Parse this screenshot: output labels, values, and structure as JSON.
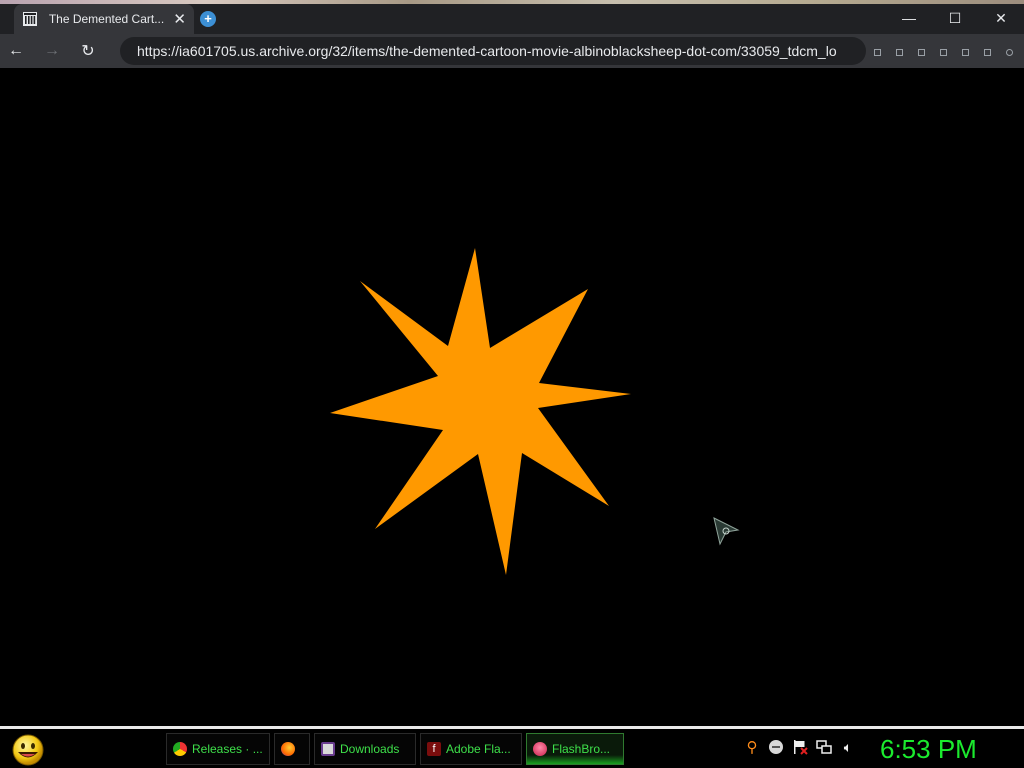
{
  "browser": {
    "tab": {
      "title": "The Demented Cart...",
      "favicon": "archive-icon",
      "close": "✕"
    },
    "new_tab_icon": "new-tab-icon",
    "window_controls": {
      "minimize": "—",
      "maximize": "☐",
      "close": "✕"
    },
    "nav": {
      "back": "←",
      "forward": "→",
      "reload": "↻"
    },
    "url": "https://ia601705.us.archive.org/32/items/the-demented-cartoon-movie-albinoblacksheep-dot-com/33059_tdcm_lo"
  },
  "content": {
    "star_color": "#ff9900",
    "background_color": "#000000",
    "cursor_icon": "arrow-cursor-icon"
  },
  "taskbar": {
    "tasks": [
      {
        "label": "Releases · ...",
        "icon": "chrome-icon"
      },
      {
        "label": "",
        "icon": "firefox-icon"
      },
      {
        "label": "Downloads",
        "icon": "folder-icon"
      },
      {
        "label": "Adobe Fla...",
        "icon": "flash-icon"
      },
      {
        "label": "FlashBro...",
        "icon": "flashbrowser-icon"
      }
    ],
    "tray": [
      "search-icon",
      "chat-icon",
      "flag-icon",
      "network-icon",
      "volume-icon"
    ],
    "clock": "6:53 PM",
    "accent": "#1bea2e"
  }
}
